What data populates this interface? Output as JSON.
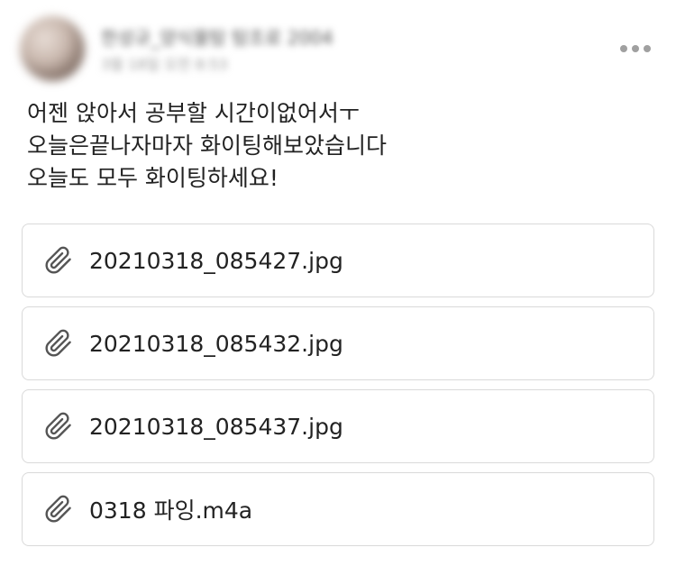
{
  "post": {
    "author": {
      "name": "한성규_양식물탐 탐조로 2004",
      "time": "3월 18일 오전 8:53"
    },
    "more_icon": "more-horizontal-icon",
    "body_lines": [
      "어젠 앉아서 공부할 시간이없어서ㅜ",
      "오늘은끝나자마자 화이팅해보았습니다",
      "오늘도 모두 화이팅하세요!"
    ],
    "attachments": [
      {
        "filename": "20210318_085427.jpg",
        "icon": "paperclip-icon"
      },
      {
        "filename": "20210318_085432.jpg",
        "icon": "paperclip-icon"
      },
      {
        "filename": "20210318_085437.jpg",
        "icon": "paperclip-icon"
      },
      {
        "filename": "0318 파잉.m4a",
        "icon": "paperclip-icon"
      }
    ]
  },
  "colors": {
    "text": "#222222",
    "border": "#d9d9d9",
    "icon": "#555555",
    "muted": "#9a9a9a"
  }
}
